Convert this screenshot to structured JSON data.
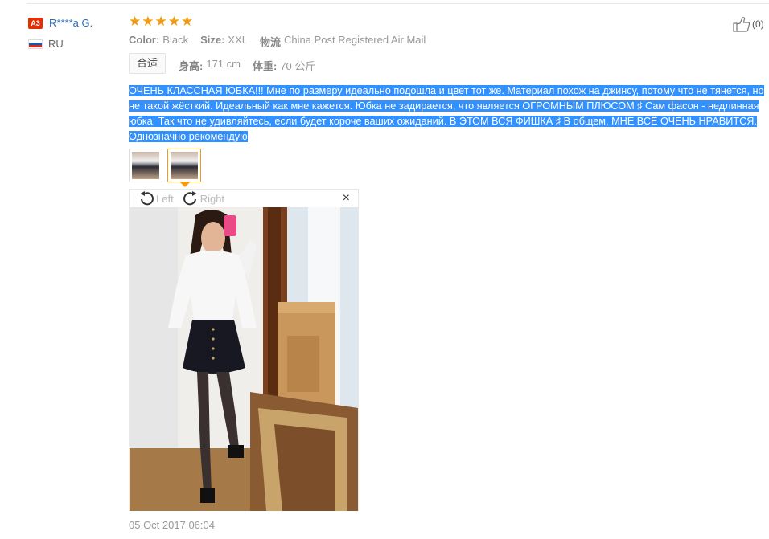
{
  "reviewer": {
    "level_badge": "A3",
    "name": "R****a G.",
    "country": "RU"
  },
  "rating": {
    "stars": 5
  },
  "helpful": {
    "count": "(0)"
  },
  "order": {
    "color_label": "Color:",
    "color_value": "Black",
    "size_label": "Size:",
    "size_value": "XXL",
    "logistics_label": "物流",
    "logistics_value": "China Post Registered Air Mail"
  },
  "fit": {
    "tag": "合适",
    "height_label": "身高:",
    "height_value": "171 cm",
    "weight_label": "体重:",
    "weight_value": "70 公斤"
  },
  "review_text": "ОЧЕНЬ КЛАССНАЯ ЮБКА!!! Мне по размеру идеально подошла и цвет тот же. Материал похож на джинсу, потому что не тянется, но не такой жёсткий. Идеальный как мне кажется. Юбка не задирается, что является ОГРОМНЫМ ПЛЮСОМ ♯ Сам фасон - недлинная юбка. Так что не удивляйтесь, если будет короче ваших ожиданий. В ЭТОМ ВСЯ ФИШКА ♯ В общем, МНЕ ВСЁ ОЧЕНЬ НРАВИТСЯ. Однозначно рекомендую",
  "viewer": {
    "rotate_left": "Left",
    "rotate_right": "Right",
    "close": "×"
  },
  "date": "05 Oct 2017 06:04",
  "colors": {
    "star": "#f39c12",
    "link": "#2a6ebb",
    "highlight": "#3390ff",
    "badge": "#e62e04"
  }
}
